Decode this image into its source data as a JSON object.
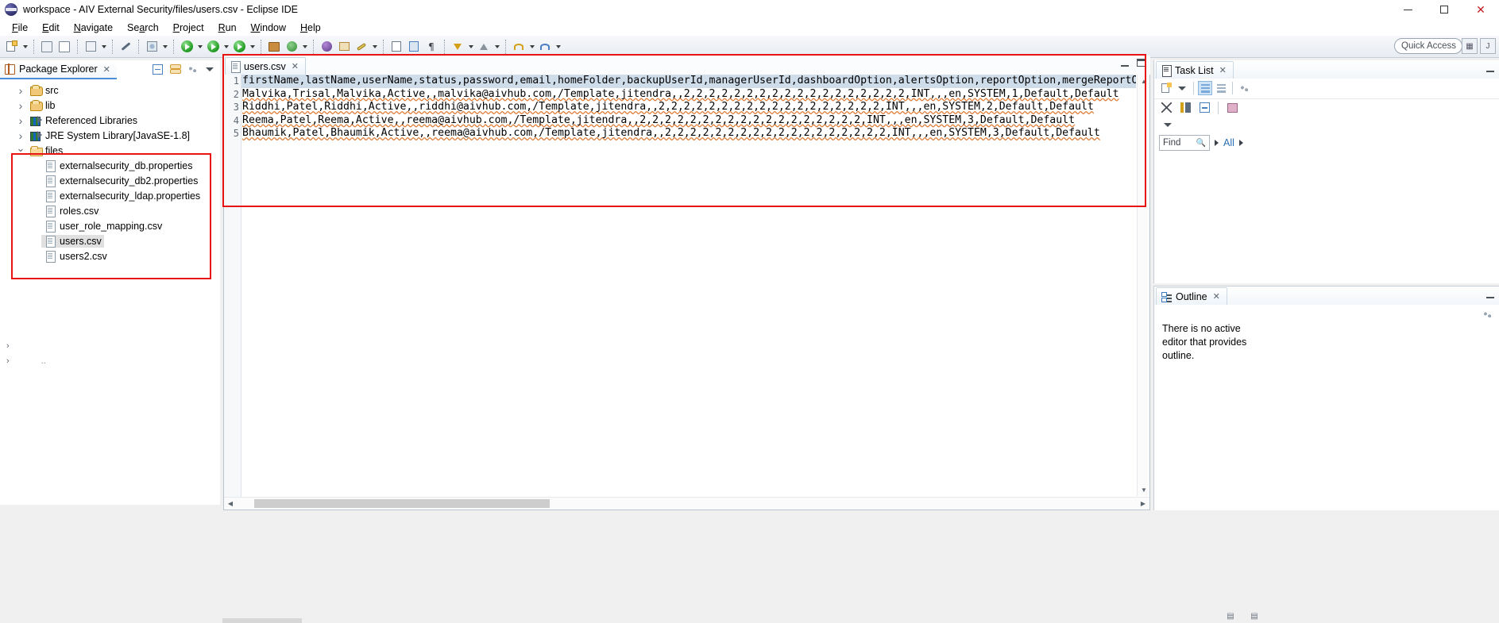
{
  "window": {
    "title": "workspace - AIV External Security/files/users.csv - Eclipse IDE",
    "icon": "eclipse-icon",
    "minimize_label": "—",
    "maximize_label": "□",
    "close_label": "✕"
  },
  "menubar": {
    "items": [
      {
        "label": "File",
        "mnemonic": "F"
      },
      {
        "label": "Edit",
        "mnemonic": "E"
      },
      {
        "label": "Navigate",
        "mnemonic": "N"
      },
      {
        "label": "Search",
        "mnemonic": "a"
      },
      {
        "label": "Project",
        "mnemonic": "P"
      },
      {
        "label": "Run",
        "mnemonic": "R"
      },
      {
        "label": "Window",
        "mnemonic": "W"
      },
      {
        "label": "Help",
        "mnemonic": "H"
      }
    ]
  },
  "toolbar": {
    "icons": [
      "new-wizard-icon",
      "save-icon",
      "save-all-icon",
      "build-icon",
      "link-icon",
      "debug-ant-icon",
      "run-icon",
      "debug-icon",
      "coverage-icon",
      "new-java-package-icon",
      "external-tools-icon",
      "open-type-icon",
      "search-icon",
      "pin-icon",
      "next-annotation-icon",
      "previous-annotation-icon",
      "back-icon",
      "forward-icon"
    ]
  },
  "quick_access": {
    "placeholder": "Quick Access",
    "search_icon": "search-icon"
  },
  "perspective_bar": {
    "open_perspective_icon": "open-perspective-icon",
    "java_perspective_icon": "java-perspective-icon"
  },
  "package_explorer": {
    "tab_label": "Package Explorer",
    "tab_icon": "package-explorer-icon",
    "close_icon": "close-icon",
    "tools": [
      "collapse-all-icon",
      "link-with-editor-icon",
      "view-menu-icon",
      "chevron-down-icon"
    ],
    "tree": [
      {
        "label": "src",
        "icon": "source-folder-icon",
        "indent": 1,
        "state": "collapsed",
        "selected": false
      },
      {
        "label": "lib",
        "icon": "package-icon",
        "indent": 1,
        "state": "collapsed",
        "selected": false
      },
      {
        "label": "Referenced Libraries",
        "icon": "library-icon",
        "indent": 1,
        "state": "collapsed",
        "selected": false
      },
      {
        "label": "JRE System Library",
        "suffix": " [JavaSE-1.8]",
        "icon": "library-icon",
        "indent": 1,
        "state": "collapsed",
        "selected": false
      },
      {
        "label": "files",
        "icon": "folder-icon",
        "indent": 1,
        "state": "expanded",
        "selected": false
      },
      {
        "label": "externalsecurity_db.properties",
        "icon": "file-icon",
        "indent": 3,
        "state": "leaf",
        "selected": false
      },
      {
        "label": "externalsecurity_db2.properties",
        "icon": "file-icon",
        "indent": 3,
        "state": "leaf",
        "selected": false
      },
      {
        "label": "externalsecurity_ldap.properties",
        "icon": "file-icon",
        "indent": 3,
        "state": "leaf",
        "selected": false
      },
      {
        "label": "roles.csv",
        "icon": "file-icon",
        "indent": 3,
        "state": "leaf",
        "selected": false
      },
      {
        "label": "user_role_mapping.csv",
        "icon": "file-icon",
        "indent": 3,
        "state": "leaf",
        "selected": false
      },
      {
        "label": "users.csv",
        "icon": "file-icon",
        "indent": 3,
        "state": "leaf",
        "selected": true
      },
      {
        "label": "users2.csv",
        "icon": "file-icon",
        "indent": 3,
        "state": "leaf",
        "selected": false
      }
    ]
  },
  "editor": {
    "tab_label": "users.csv",
    "tab_icon": "text-file-icon",
    "close_icon": "close-icon",
    "minimize_icon": "minimize-icon",
    "maximize_icon": "maximize-icon",
    "lines": [
      {
        "num": "1",
        "text": "firstName,lastName,userName,status,password,email,homeFolder,backupUserId,managerUserId,dashboardOption,alertsOption,reportOption,mergeReportOption,a",
        "highlighted": true
      },
      {
        "num": "2",
        "text": "Malvika,Trisal,Malvika,Active,,malvika@aivhub.com,/Template,jitendra,,2,2,2,2,2,2,2,2,2,2,2,2,2,2,2,2,2,2,INT,,,en,SYSTEM,1,Default,Default",
        "highlighted": false
      },
      {
        "num": "3",
        "text": "Riddhi,Patel,Riddhi,Active,,riddhi@aivhub.com,/Template,jitendra,,2,2,2,2,2,2,2,2,2,2,2,2,2,2,2,2,2,2,INT,,,en,SYSTEM,2,Default,Default",
        "highlighted": false
      },
      {
        "num": "4",
        "text": "Reema,Patel,Reema,Active,,reema@aivhub.com,/Template,jitendra,,2,2,2,2,2,2,2,2,2,2,2,2,2,2,2,2,2,2,INT,,,en,SYSTEM,3,Default,Default",
        "highlighted": false
      },
      {
        "num": "5",
        "text": "Bhaumik,Patel,Bhaumik,Active,,reema@aivhub.com,/Template,jitendra,,2,2,2,2,2,2,2,2,2,2,2,2,2,2,2,2,2,2,INT,,,en,SYSTEM,3,Default,Default",
        "highlighted": false
      }
    ],
    "scroll_up_icon": "chevron-up-icon",
    "scroll_down_icon": "chevron-down-icon",
    "scroll_left_icon": "chevron-left-icon",
    "scroll_right_icon": "chevron-right-icon"
  },
  "task_list": {
    "tab_label": "Task List",
    "tab_icon": "task-list-icon",
    "close_icon": "close-icon",
    "minimize_icon": "minimize-icon",
    "toolbar_row1": [
      "new-task-icon",
      "chevron-down-icon",
      "categorized-presentation-icon",
      "scheduled-presentation-icon",
      "view-menu-icon"
    ],
    "toolbar_row2": [
      "focus-on-workweek-icon",
      "synchronize-changed-icon",
      "collapse-all-icon",
      "restore-tasks-icon"
    ],
    "toolbar_row3": [
      "chevron-down-icon"
    ],
    "find_placeholder": "Find",
    "find_icon": "search-icon",
    "all_label": "All"
  },
  "outline": {
    "tab_label": "Outline",
    "tab_icon": "outline-icon",
    "close_icon": "close-icon",
    "minimize_icon": "minimize-icon",
    "view_menu_icon": "view-menu-icon",
    "message": "There is no active editor that provides outline."
  },
  "annotations": {
    "highlight_color": "#e81313",
    "boxes": [
      "files-folder-highlight",
      "editor-highlight"
    ]
  }
}
